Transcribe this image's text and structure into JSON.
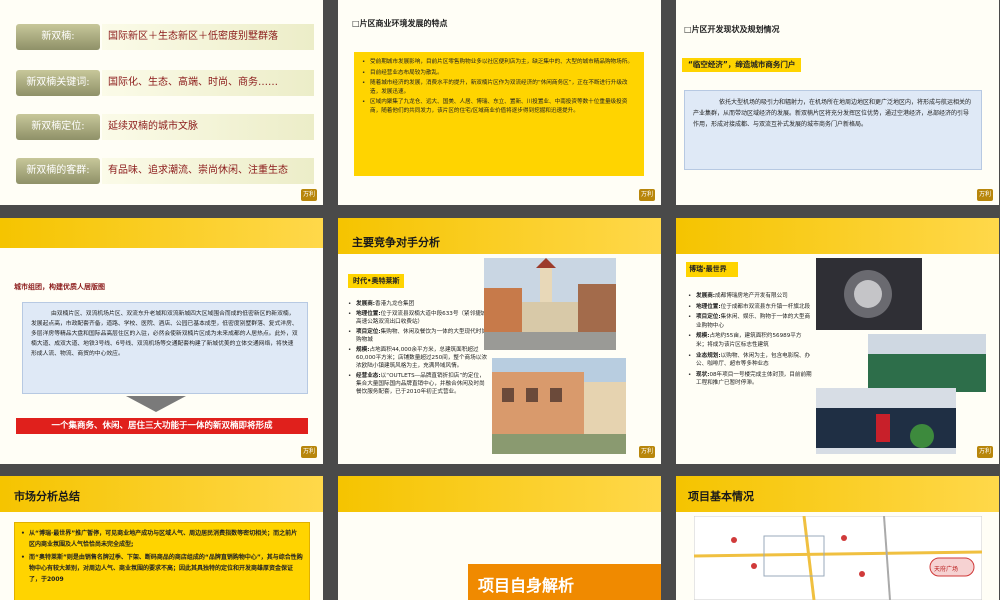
{
  "slide1": {
    "rows": [
      {
        "label": "新双楠:",
        "value": "国际新区＋生态新区＋低密度别墅群落"
      },
      {
        "label": "新双楠关键词:",
        "value": "国际化、生态、高端、时尚、商务……"
      },
      {
        "label": "新双楠定位:",
        "value": "延续双楠的城市文脉"
      },
      {
        "label": "新双楠的客群:",
        "value": "有品味、追求潮流、崇尚休闲、注重生态"
      }
    ]
  },
  "slide2": {
    "heading": "片区商业环境发展的特点",
    "bullets": [
      "受前期城市发展影响，目前片区零售购物业多以社区便利店为主，缺乏集中的、大型的城市精品购物场所。",
      "目前经营业态布局较为散乱。",
      "随着城市经济的发展，消费水平的提升，新双楠片区作为双流经济的“休闲商务区”，正在不断进行升级改造，发展迅速。",
      "区域内聚集了九龙仓、远大、国美、人居、博瑞、东立、置新、川投置业、中南投资等数十位重量级投资商，随着他们的共同发力，该片区的住宅/区域商业价值将逐步得到挖掘和迅速提升。"
    ]
  },
  "slide3": {
    "heading": "片区开发现状及规划情况",
    "tag": "“临空经济”，缔造城市商务门户",
    "body": "依托大型机场的吸引力和辐射力，在机场所在地周边地区和更广泛地区内，将形成与航运相关的产业集群，从而带动区域经济的发展。新双楠片区将充分发挥区位优势，通过空港经济，总部经济的引导作用，形成对接成都、与双流互补式发展的城市商务门户新格局。"
  },
  "slide4": {
    "tag": "城市组团，构建优质人居版图",
    "body": "由双楠片区、双流机场片区、双流东升老城和双流新城四大区域围合而成的低密新区的新双楠，发展起点高，市政配套齐备，道路、学校、医院、酒店、公园已基本成型，低密度别墅群落、复式洋房、多层洋房等精品大盘和国际品高层住区的入驻，必然会使新双楠片区成为未来成都的人居热点。此外，双楠大道、成双大道、地铁3号线、6号线、双流机场等交通配套构建了新城优美的立体交通网络，将快速形成人流、物流、商贸的中心效应。",
    "banner": "一个集商务、休闲、居住三大功能于一体的新双楠即将形成"
  },
  "slide5": {
    "title": "主要竞争对手分析",
    "tag": "时代•奥特莱斯",
    "items": [
      {
        "k": "发展商:",
        "v": "香港九龙仓集团"
      },
      {
        "k": "地理位置:",
        "v": "位于双流县双楠大道中段633号（紧邻捷城高速公路双流出口收费站）"
      },
      {
        "k": "项目定位:",
        "v": "集购物、休闲及餐饮为一体的大型现代时尚购物城"
      },
      {
        "k": "规模:",
        "v": "占地面积44,000余平方米，总建筑面积超过60,000平方米；店铺数量超过250间，整个商场以浓浓欧陆小镇建筑风格为主，充满异域风情。"
      },
      {
        "k": "经营业态:",
        "v": "以“OUTLETS—品牌直销折扣店”的定位，集合大量国际国内品牌直销中心，并融合休闲及时尚餐饮服务配套，已于2010年初正式营业。"
      }
    ]
  },
  "slide6": {
    "tag": "博瑞·最世界",
    "items": [
      {
        "k": "发展商:",
        "v": "成都博瑞房地产开发有限公司"
      },
      {
        "k": "地理位置:",
        "v": "位于成都市双流县东升镇一杆旗北段"
      },
      {
        "k": "项目定位:",
        "v": "集休闲、娱乐、购物于一体的大型商业购物中心"
      },
      {
        "k": "规模:",
        "v": "占地约55亩，建筑面积约56989平方米；将成为该片区标志性建筑"
      },
      {
        "k": "业态规划:",
        "v": "以购物、休闲为主，包含电影院、办公、咖啡厅、超市等多种业态"
      },
      {
        "k": "现状:",
        "v": "08年项目一号楼完成主体封顶，目前前期工程和推广已暂时停滞。"
      }
    ]
  },
  "slide7": {
    "title": "市场分析总结",
    "bullets": [
      "从“博瑞·最世界”推广暂停，可见商业地产成功与区域人气、周边居民消费指数等密切相关；而之前片区内商业氛围及人气恰恰尚未完全成型;",
      "而“奥特莱斯”则是由销售名牌过季、下架、断码商品的商店组成的“品牌直销购物中心”，其与综合性购物中心有较大差别，对周边人气、商业氛围的要求不高；因此其具独特的定位和开发商雄厚资金保证了，于2009"
    ]
  },
  "slide8": {
    "title": "项目自身解析"
  },
  "slide9": {
    "title": "项目基本情况",
    "map_label": "天府广场"
  },
  "logo_text": "万利",
  "colors": {
    "accent": "#ffd400",
    "red": "#e0201c",
    "maroon": "#8b1a1a"
  }
}
